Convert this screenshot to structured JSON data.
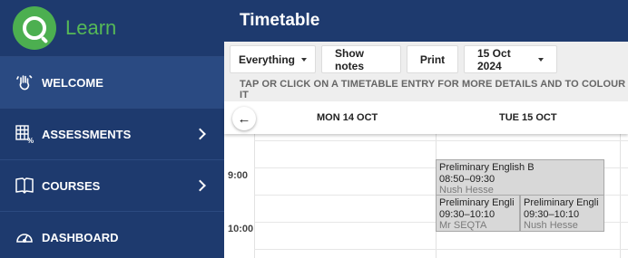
{
  "app": {
    "name": "Learn"
  },
  "sidebar": {
    "items": [
      {
        "label": "WELCOME",
        "active": true
      },
      {
        "label": "ASSESSMENTS",
        "chevron": true
      },
      {
        "label": "COURSES",
        "chevron": true
      },
      {
        "label": "DASHBOARD"
      }
    ]
  },
  "header": {
    "title": "Timetable"
  },
  "toolbar": {
    "filter_label": "Everything",
    "show_notes_label": "Show notes",
    "print_label": "Print",
    "date_label": "15 Oct 2024"
  },
  "hint": "TAP OR CLICK ON A TIMETABLE ENTRY FOR MORE DETAILS AND TO COLOUR IT",
  "days": [
    "MON 14 OCT",
    "TUE 15 OCT"
  ],
  "times": [
    "9:00",
    "10:00"
  ],
  "events": [
    {
      "subject": "Preliminary English B",
      "time": "08:50–09:30",
      "teacher": "Nush Hesse"
    },
    {
      "subject": "Preliminary Engli",
      "time": "09:30–10:10",
      "teacher": "Mr SEQTA"
    },
    {
      "subject": "Preliminary Engli",
      "time": "09:30–10:10",
      "teacher": "Nush Hesse"
    }
  ],
  "colors": {
    "sidebar": "#1e3a6e",
    "brand": "#4caf50",
    "event_bg": "#d8d8d8"
  }
}
